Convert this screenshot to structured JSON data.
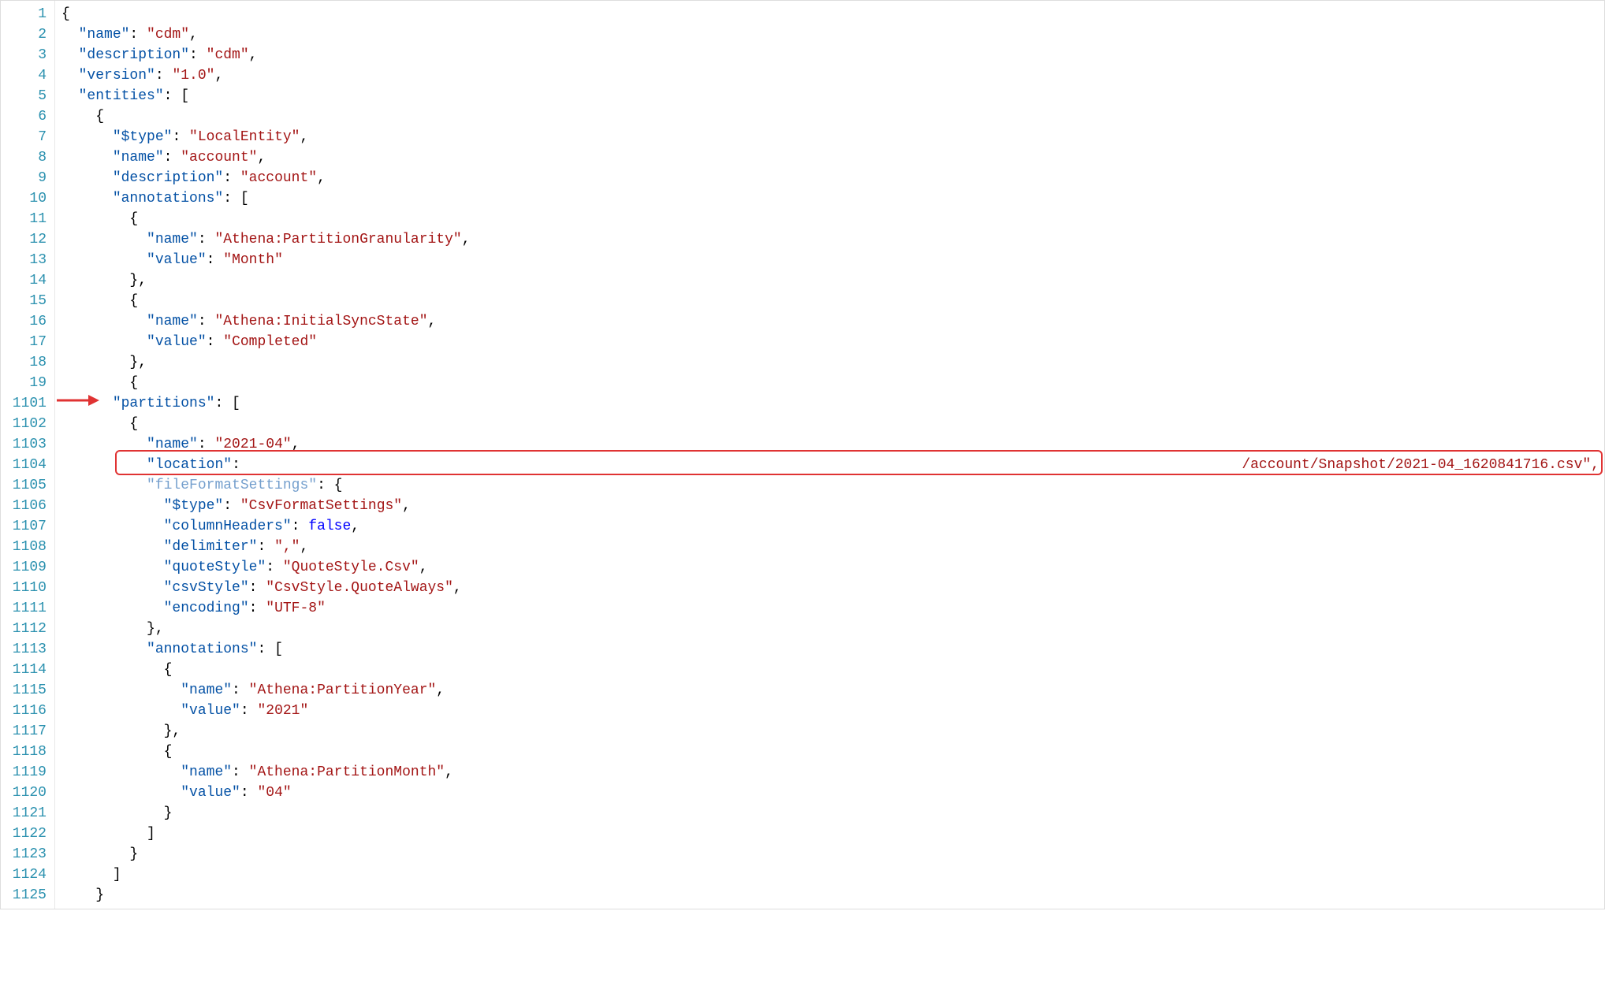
{
  "lines": [
    {
      "num": "1",
      "indent": 0,
      "tokens": [
        {
          "t": "p",
          "v": "{"
        }
      ]
    },
    {
      "num": "2",
      "indent": 1,
      "tokens": [
        {
          "t": "k",
          "v": "\"name\""
        },
        {
          "t": "p",
          "v": ": "
        },
        {
          "t": "s",
          "v": "\"cdm\""
        },
        {
          "t": "p",
          "v": ","
        }
      ]
    },
    {
      "num": "3",
      "indent": 1,
      "tokens": [
        {
          "t": "k",
          "v": "\"description\""
        },
        {
          "t": "p",
          "v": ": "
        },
        {
          "t": "s",
          "v": "\"cdm\""
        },
        {
          "t": "p",
          "v": ","
        }
      ]
    },
    {
      "num": "4",
      "indent": 1,
      "tokens": [
        {
          "t": "k",
          "v": "\"version\""
        },
        {
          "t": "p",
          "v": ": "
        },
        {
          "t": "s",
          "v": "\"1.0\""
        },
        {
          "t": "p",
          "v": ","
        }
      ]
    },
    {
      "num": "5",
      "indent": 1,
      "tokens": [
        {
          "t": "k",
          "v": "\"entities\""
        },
        {
          "t": "p",
          "v": ": ["
        }
      ]
    },
    {
      "num": "6",
      "indent": 2,
      "tokens": [
        {
          "t": "p",
          "v": "{"
        }
      ]
    },
    {
      "num": "7",
      "indent": 3,
      "tokens": [
        {
          "t": "k",
          "v": "\"$type\""
        },
        {
          "t": "p",
          "v": ": "
        },
        {
          "t": "s",
          "v": "\"LocalEntity\""
        },
        {
          "t": "p",
          "v": ","
        }
      ]
    },
    {
      "num": "8",
      "indent": 3,
      "tokens": [
        {
          "t": "k",
          "v": "\"name\""
        },
        {
          "t": "p",
          "v": ": "
        },
        {
          "t": "s",
          "v": "\"account\""
        },
        {
          "t": "p",
          "v": ","
        }
      ]
    },
    {
      "num": "9",
      "indent": 3,
      "tokens": [
        {
          "t": "k",
          "v": "\"description\""
        },
        {
          "t": "p",
          "v": ": "
        },
        {
          "t": "s",
          "v": "\"account\""
        },
        {
          "t": "p",
          "v": ","
        }
      ]
    },
    {
      "num": "10",
      "indent": 3,
      "tokens": [
        {
          "t": "k",
          "v": "\"annotations\""
        },
        {
          "t": "p",
          "v": ": ["
        }
      ]
    },
    {
      "num": "11",
      "indent": 4,
      "tokens": [
        {
          "t": "p",
          "v": "{"
        }
      ]
    },
    {
      "num": "12",
      "indent": 5,
      "tokens": [
        {
          "t": "k",
          "v": "\"name\""
        },
        {
          "t": "p",
          "v": ": "
        },
        {
          "t": "s",
          "v": "\"Athena:PartitionGranularity\""
        },
        {
          "t": "p",
          "v": ","
        }
      ]
    },
    {
      "num": "13",
      "indent": 5,
      "tokens": [
        {
          "t": "k",
          "v": "\"value\""
        },
        {
          "t": "p",
          "v": ": "
        },
        {
          "t": "s",
          "v": "\"Month\""
        }
      ]
    },
    {
      "num": "14",
      "indent": 4,
      "tokens": [
        {
          "t": "p",
          "v": "},"
        }
      ]
    },
    {
      "num": "15",
      "indent": 4,
      "tokens": [
        {
          "t": "p",
          "v": "{"
        }
      ]
    },
    {
      "num": "16",
      "indent": 5,
      "tokens": [
        {
          "t": "k",
          "v": "\"name\""
        },
        {
          "t": "p",
          "v": ": "
        },
        {
          "t": "s",
          "v": "\"Athena:InitialSyncState\""
        },
        {
          "t": "p",
          "v": ","
        }
      ]
    },
    {
      "num": "17",
      "indent": 5,
      "tokens": [
        {
          "t": "k",
          "v": "\"value\""
        },
        {
          "t": "p",
          "v": ": "
        },
        {
          "t": "s",
          "v": "\"Completed\""
        }
      ]
    },
    {
      "num": "18",
      "indent": 4,
      "tokens": [
        {
          "t": "p",
          "v": "},"
        }
      ]
    },
    {
      "num": "19",
      "indent": 4,
      "tokens": [
        {
          "t": "p",
          "v": "{"
        }
      ]
    },
    {
      "num": "1101",
      "indent": 3,
      "tokens": [
        {
          "t": "k",
          "v": "\"partitions\""
        },
        {
          "t": "p",
          "v": ": ["
        }
      ],
      "arrowTarget": true
    },
    {
      "num": "1102",
      "indent": 4,
      "tokens": [
        {
          "t": "p",
          "v": "{"
        }
      ]
    },
    {
      "num": "1103",
      "indent": 5,
      "tokens": [
        {
          "t": "k",
          "v": "\"name\""
        },
        {
          "t": "p",
          "v": ": "
        },
        {
          "t": "s",
          "v": "\"2021-04\""
        },
        {
          "t": "p",
          "v": ","
        }
      ]
    },
    {
      "num": "1104",
      "indent": 5,
      "tokens": [
        {
          "t": "k",
          "v": "\"location\""
        },
        {
          "t": "p",
          "v": ": "
        }
      ],
      "highlighted": true,
      "trailing": "/account/Snapshot/2021-04_1620841716.csv\","
    },
    {
      "num": "1105",
      "indent": 5,
      "tokens": [
        {
          "t": "k",
          "v": "\"fileFormatSettings\""
        },
        {
          "t": "p",
          "v": ": {"
        }
      ],
      "faded": true
    },
    {
      "num": "1106",
      "indent": 6,
      "tokens": [
        {
          "t": "k",
          "v": "\"$type\""
        },
        {
          "t": "p",
          "v": ": "
        },
        {
          "t": "s",
          "v": "\"CsvFormatSettings\""
        },
        {
          "t": "p",
          "v": ","
        }
      ]
    },
    {
      "num": "1107",
      "indent": 6,
      "tokens": [
        {
          "t": "k",
          "v": "\"columnHeaders\""
        },
        {
          "t": "p",
          "v": ": "
        },
        {
          "t": "b",
          "v": "false"
        },
        {
          "t": "p",
          "v": ","
        }
      ]
    },
    {
      "num": "1108",
      "indent": 6,
      "tokens": [
        {
          "t": "k",
          "v": "\"delimiter\""
        },
        {
          "t": "p",
          "v": ": "
        },
        {
          "t": "s",
          "v": "\",\""
        },
        {
          "t": "p",
          "v": ","
        }
      ]
    },
    {
      "num": "1109",
      "indent": 6,
      "tokens": [
        {
          "t": "k",
          "v": "\"quoteStyle\""
        },
        {
          "t": "p",
          "v": ": "
        },
        {
          "t": "s",
          "v": "\"QuoteStyle.Csv\""
        },
        {
          "t": "p",
          "v": ","
        }
      ]
    },
    {
      "num": "1110",
      "indent": 6,
      "tokens": [
        {
          "t": "k",
          "v": "\"csvStyle\""
        },
        {
          "t": "p",
          "v": ": "
        },
        {
          "t": "s",
          "v": "\"CsvStyle.QuoteAlways\""
        },
        {
          "t": "p",
          "v": ","
        }
      ]
    },
    {
      "num": "1111",
      "indent": 6,
      "tokens": [
        {
          "t": "k",
          "v": "\"encoding\""
        },
        {
          "t": "p",
          "v": ": "
        },
        {
          "t": "s",
          "v": "\"UTF-8\""
        }
      ]
    },
    {
      "num": "1112",
      "indent": 5,
      "tokens": [
        {
          "t": "p",
          "v": "},"
        }
      ]
    },
    {
      "num": "1113",
      "indent": 5,
      "tokens": [
        {
          "t": "k",
          "v": "\"annotations\""
        },
        {
          "t": "p",
          "v": ": ["
        }
      ]
    },
    {
      "num": "1114",
      "indent": 6,
      "tokens": [
        {
          "t": "p",
          "v": "{"
        }
      ]
    },
    {
      "num": "1115",
      "indent": 7,
      "tokens": [
        {
          "t": "k",
          "v": "\"name\""
        },
        {
          "t": "p",
          "v": ": "
        },
        {
          "t": "s",
          "v": "\"Athena:PartitionYear\""
        },
        {
          "t": "p",
          "v": ","
        }
      ]
    },
    {
      "num": "1116",
      "indent": 7,
      "tokens": [
        {
          "t": "k",
          "v": "\"value\""
        },
        {
          "t": "p",
          "v": ": "
        },
        {
          "t": "s",
          "v": "\"2021\""
        }
      ]
    },
    {
      "num": "1117",
      "indent": 6,
      "tokens": [
        {
          "t": "p",
          "v": "},"
        }
      ]
    },
    {
      "num": "1118",
      "indent": 6,
      "tokens": [
        {
          "t": "p",
          "v": "{"
        }
      ]
    },
    {
      "num": "1119",
      "indent": 7,
      "tokens": [
        {
          "t": "k",
          "v": "\"name\""
        },
        {
          "t": "p",
          "v": ": "
        },
        {
          "t": "s",
          "v": "\"Athena:PartitionMonth\""
        },
        {
          "t": "p",
          "v": ","
        }
      ]
    },
    {
      "num": "1120",
      "indent": 7,
      "tokens": [
        {
          "t": "k",
          "v": "\"value\""
        },
        {
          "t": "p",
          "v": ": "
        },
        {
          "t": "s",
          "v": "\"04\""
        }
      ]
    },
    {
      "num": "1121",
      "indent": 6,
      "tokens": [
        {
          "t": "p",
          "v": "}"
        }
      ]
    },
    {
      "num": "1122",
      "indent": 5,
      "tokens": [
        {
          "t": "p",
          "v": "]"
        }
      ]
    },
    {
      "num": "1123",
      "indent": 4,
      "tokens": [
        {
          "t": "p",
          "v": "}"
        }
      ]
    },
    {
      "num": "1124",
      "indent": 3,
      "tokens": [
        {
          "t": "p",
          "v": "]"
        }
      ]
    },
    {
      "num": "1125",
      "indent": 2,
      "tokens": [
        {
          "t": "p",
          "v": "}"
        }
      ]
    }
  ],
  "annotation": {
    "arrow_color": "#e03333",
    "highlight_color": "#e03333"
  }
}
